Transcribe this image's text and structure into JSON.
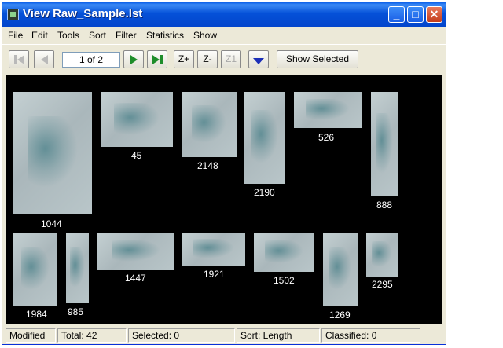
{
  "window": {
    "title": "View  Raw_Sample.lst",
    "min": "_",
    "max": "□",
    "close": "✕"
  },
  "menu": [
    "File",
    "Edit",
    "Tools",
    "Sort",
    "Filter",
    "Statistics",
    "Show"
  ],
  "toolbar": {
    "page": "1 of 2",
    "zoom_in": "Z+",
    "zoom_out": "Z-",
    "zoom_one": "Z1",
    "show_selected": "Show Selected"
  },
  "particles": [
    {
      "label": "1044"
    },
    {
      "label": "45"
    },
    {
      "label": "2148"
    },
    {
      "label": "2190"
    },
    {
      "label": "526"
    },
    {
      "label": "888"
    },
    {
      "label": "1984"
    },
    {
      "label": "985"
    },
    {
      "label": "1447"
    },
    {
      "label": "1921"
    },
    {
      "label": "1502"
    },
    {
      "label": "1269"
    },
    {
      "label": "2295"
    }
  ],
  "status": {
    "modified": "Modified",
    "total": "Total:  42",
    "selected": "Selected:  0",
    "sort": "Sort: Length",
    "classified": "Classified:  0"
  }
}
